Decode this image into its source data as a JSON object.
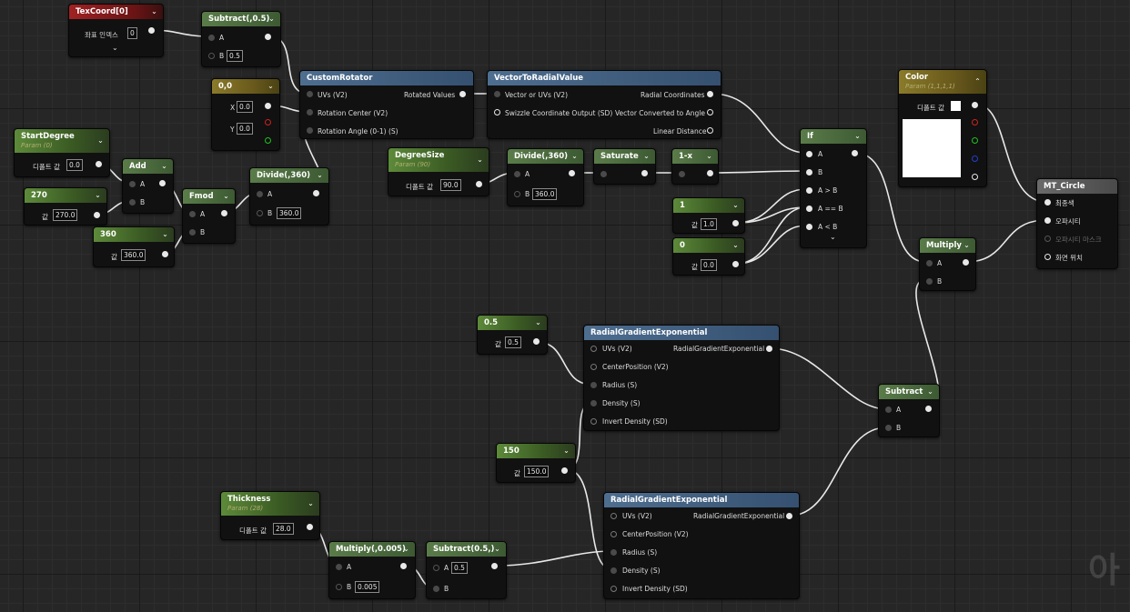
{
  "nodes": {
    "texcoord": {
      "title": "TexCoord[0]",
      "label": "좌표 인덱스",
      "value": "0"
    },
    "subtract1": {
      "title": "Subtract(,0.5)",
      "a": "A",
      "b": "B",
      "b_value": "0.5"
    },
    "custom_rotator": {
      "title": "CustomRotator",
      "in1": "UVs (V2)",
      "in2": "Rotation Center (V2)",
      "in3": "Rotation Angle (0-1) (S)",
      "out": "Rotated Values"
    },
    "vector_to_radial": {
      "title": "VectorToRadialValue",
      "in1": "Vector or UVs (V2)",
      "in2": "Swizzle Coordinate Output (SD)",
      "out1": "Radial Coordinates",
      "out2": "Vector Converted to Angle",
      "out3": "Linear Distance"
    },
    "const00": {
      "title": "0,0",
      "x_label": "X",
      "x_value": "0.0",
      "y_label": "Y",
      "y_value": "0.0"
    },
    "start_degree": {
      "title": "StartDegree",
      "sub": "Param (0)",
      "label": "디폴트 값",
      "value": "0.0"
    },
    "c270": {
      "title": "270",
      "label": "값",
      "value": "270.0"
    },
    "c360": {
      "title": "360",
      "label": "값",
      "value": "360.0"
    },
    "add": {
      "title": "Add",
      "a": "A",
      "b": "B"
    },
    "fmod": {
      "title": "Fmod",
      "a": "A",
      "b": "B"
    },
    "divide360a": {
      "title": "Divide(,360)",
      "a": "A",
      "b": "B",
      "b_value": "360.0"
    },
    "degree_size": {
      "title": "DegreeSize",
      "sub": "Param (90)",
      "label": "디폴트 값",
      "value": "90.0"
    },
    "divide360b": {
      "title": "Divide(,360)",
      "a": "A",
      "b": "B",
      "b_value": "360.0"
    },
    "saturate": {
      "title": "Saturate"
    },
    "one_minus": {
      "title": "1-x"
    },
    "c1": {
      "title": "1",
      "label": "값",
      "value": "1.0"
    },
    "c0": {
      "title": "0",
      "label": "값",
      "value": "0.0"
    },
    "if": {
      "title": "If",
      "a": "A",
      "b": "B",
      "agb": "A > B",
      "aeb": "A == B",
      "alb": "A < B"
    },
    "color": {
      "title": "Color",
      "sub": "Param (1,1,1,1)",
      "label": "디폴트 값"
    },
    "multiply1": {
      "title": "Multiply",
      "a": "A",
      "b": "B"
    },
    "mt_circle": {
      "title": "MT_Circle",
      "p1": "최종색",
      "p2": "오파시티",
      "p3": "오파시티 마스크",
      "p4": "화면 위치"
    },
    "c05": {
      "title": "0.5",
      "label": "값",
      "value": "0.5"
    },
    "rge1": {
      "title": "RadialGradientExponential",
      "in1": "UVs (V2)",
      "in2": "CenterPosition (V2)",
      "in3": "Radius (S)",
      "in4": "Density (S)",
      "in5": "Invert Density (SD)",
      "out": "RadialGradientExponential"
    },
    "subtract2": {
      "title": "Subtract",
      "a": "A",
      "b": "B"
    },
    "c150": {
      "title": "150",
      "label": "값",
      "value": "150.0"
    },
    "rge2": {
      "title": "RadialGradientExponential",
      "in1": "UVs (V2)",
      "in2": "CenterPosition (V2)",
      "in3": "Radius (S)",
      "in4": "Density (S)",
      "in5": "Invert Density (SD)",
      "out": "RadialGradientExponential"
    },
    "thickness": {
      "title": "Thickness",
      "sub": "Param (28)",
      "label": "디폴트 값",
      "value": "28.0"
    },
    "multiply005": {
      "title": "Multiply(,0.005)",
      "a": "A",
      "b": "B",
      "b_value": "0.005"
    },
    "subtract05": {
      "title": "Subtract(0.5,)",
      "a": "A",
      "a_value": "0.5",
      "b": "B"
    }
  },
  "colors": {
    "param": "#5d8a3a",
    "texcoord": "#a02223",
    "function": "#4e6e90",
    "vector": "#8a7a2a",
    "wire": "#e8e8e8"
  },
  "watermark": "아"
}
